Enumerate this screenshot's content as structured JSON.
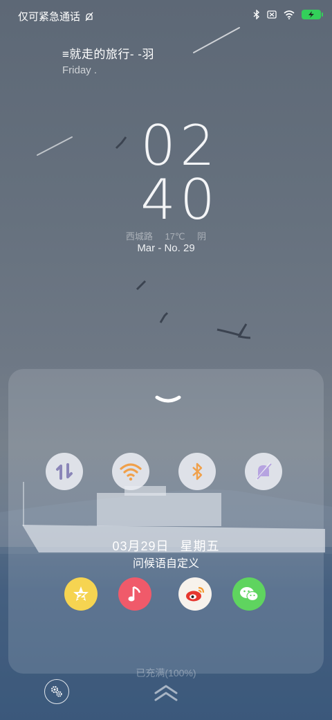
{
  "status_bar": {
    "carrier_text": "仅可紧急通话",
    "icons": [
      "notification-mute-icon",
      "bluetooth-icon",
      "no-sim-icon",
      "wifi-icon",
      "battery-charging-icon"
    ],
    "battery_color": "#33d05a"
  },
  "lyrics": {
    "line": "≡就走的旅行-     -羽",
    "subline": "Friday ."
  },
  "clock": {
    "hour": "02",
    "minute": "40"
  },
  "weather": {
    "location": "西城路",
    "temperature": "17℃",
    "condition": "阴"
  },
  "date": {
    "text": "Mar - No. 29"
  },
  "panel": {
    "toggles": [
      {
        "name": "data-toggle",
        "icon": "data-transfer-icon",
        "color": "#8a85b8"
      },
      {
        "name": "wifi-toggle",
        "icon": "wifi-icon",
        "color": "#f0a04a"
      },
      {
        "name": "bluetooth-toggle",
        "icon": "bluetooth-icon",
        "color": "#f0a04a"
      },
      {
        "name": "silent-toggle",
        "icon": "bell-off-icon",
        "color": "#b6a3e0"
      }
    ],
    "greeting_date": "03月29日",
    "greeting_weekday": "星期五",
    "greeting_text": "问候语自定义",
    "apps": [
      {
        "name": "qq-space-app",
        "icon": "star-icon",
        "color": "#f6d451"
      },
      {
        "name": "music-app",
        "icon": "music-note-icon",
        "color": "#f05a6a"
      },
      {
        "name": "weibo-app",
        "icon": "weibo-icon",
        "color": "#f7f2ec"
      },
      {
        "name": "wechat-app",
        "icon": "wechat-icon",
        "color": "#5fd45f"
      }
    ],
    "charge_status": "已充满(100%)"
  }
}
